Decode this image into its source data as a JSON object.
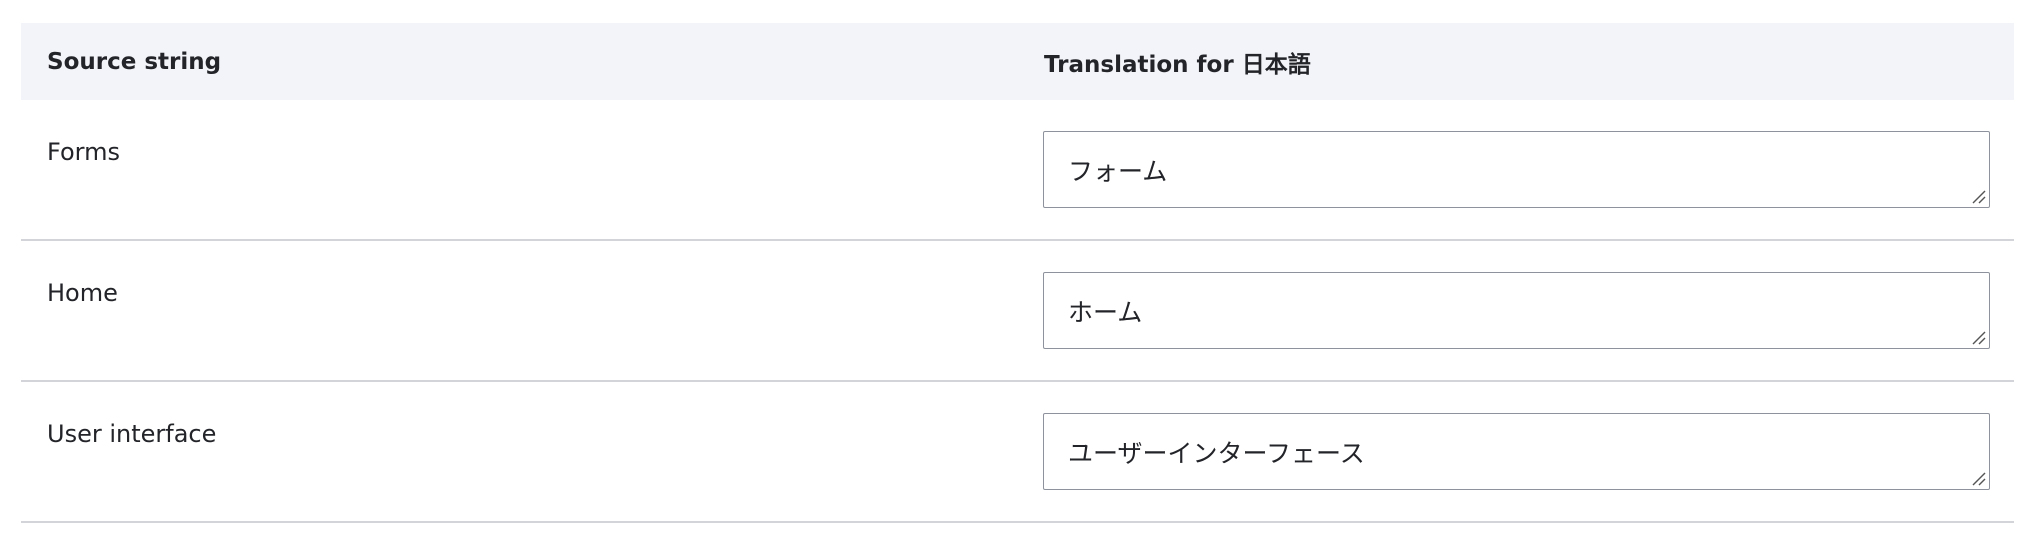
{
  "table": {
    "headers": {
      "source": "Source string",
      "translation": "Translation for 日本語"
    },
    "rows": [
      {
        "source": "Forms",
        "translation": "フォーム"
      },
      {
        "source": "Home",
        "translation": "ホーム"
      },
      {
        "source": "User interface",
        "translation": "ユーザーインターフェース"
      }
    ]
  }
}
